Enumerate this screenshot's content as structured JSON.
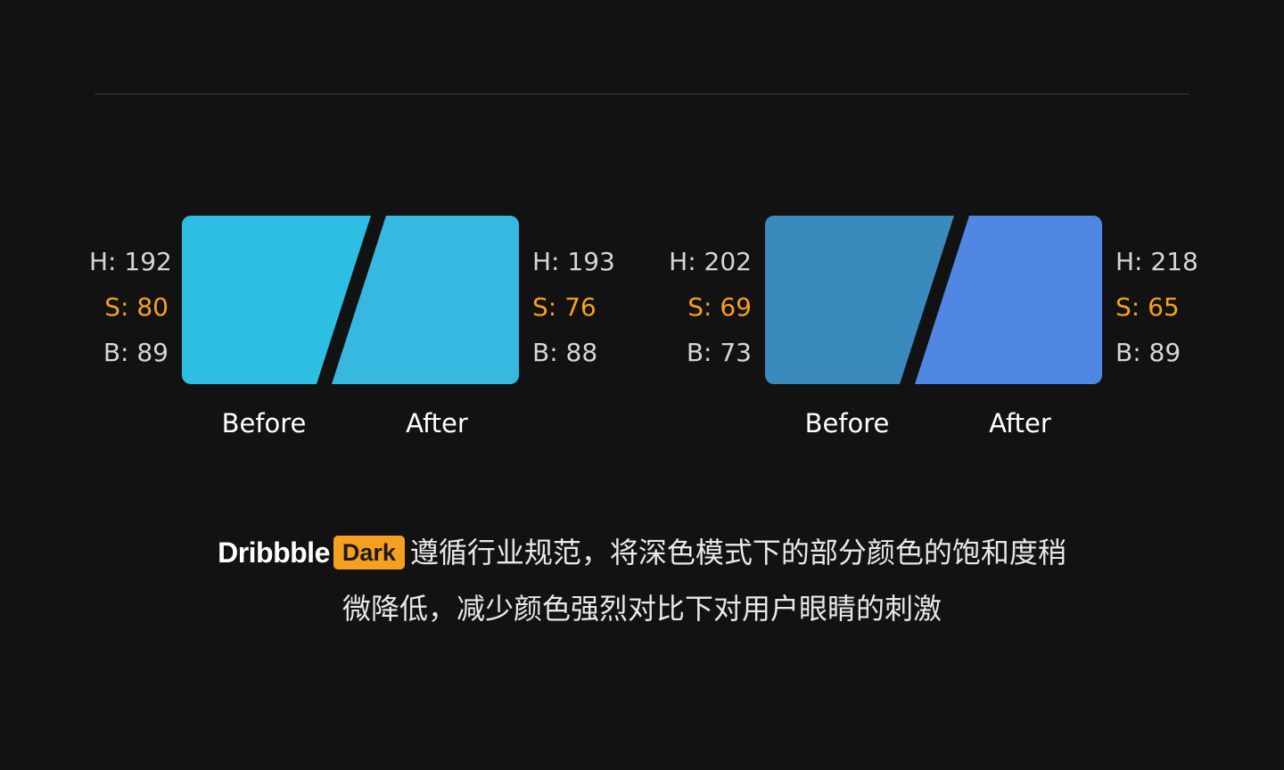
{
  "groups": [
    {
      "before": {
        "h": "H: 192",
        "s": "S: 80",
        "b": "B: 89",
        "color": "#2EBEE3"
      },
      "after": {
        "h": "H: 193",
        "s": "S: 76",
        "b": "B: 88",
        "color": "#36B8E0"
      },
      "before_label": "Before",
      "after_label": "After"
    },
    {
      "before": {
        "h": "H: 202",
        "s": "S: 69",
        "b": "B: 73",
        "color": "#3A8ABE"
      },
      "after": {
        "h": "H: 218",
        "s": "S: 65",
        "b": "B: 89",
        "color": "#4F87E3"
      },
      "before_label": "Before",
      "after_label": "After"
    }
  ],
  "description": {
    "brand": "Dribbble",
    "badge": "Dark",
    "line1": "遵循行业规范，将深色模式下的部分颜色的饱和度稍",
    "line2": "微降低，减少颜色强烈对比下对用户眼睛的刺激"
  },
  "colors": {
    "background": "#121212",
    "accent": "#F5A020",
    "divider": "#3A3A3A"
  }
}
